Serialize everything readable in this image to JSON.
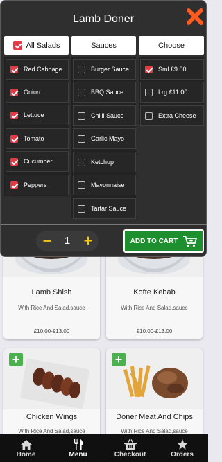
{
  "modal": {
    "title": "Lamb Doner",
    "columns": {
      "salads": {
        "header": "All Salads",
        "header_checked": true,
        "items": [
          {
            "label": "Red Cabbage",
            "checked": true
          },
          {
            "label": "Onion",
            "checked": true
          },
          {
            "label": "Lettuce",
            "checked": true
          },
          {
            "label": "Tomato",
            "checked": true
          },
          {
            "label": "Cucumber",
            "checked": true
          },
          {
            "label": "Peppers",
            "checked": true
          }
        ]
      },
      "sauces": {
        "header": "Sauces",
        "items": [
          {
            "label": "Burger Sauce",
            "checked": false
          },
          {
            "label": "BBQ Sauce",
            "checked": false
          },
          {
            "label": "Chilli Sauce",
            "checked": false
          },
          {
            "label": "Garlic Mayo",
            "checked": false
          },
          {
            "label": "Ketchup",
            "checked": false
          },
          {
            "label": "Mayonnaise",
            "checked": false
          },
          {
            "label": "Tartar Sauce",
            "checked": false
          }
        ]
      },
      "choose": {
        "header": "Choose",
        "items": [
          {
            "label": "Sml £9.00",
            "checked": true
          },
          {
            "label": "Lrg £11.00",
            "checked": false
          },
          {
            "label": "Extra Cheese",
            "checked": false
          }
        ]
      }
    },
    "quantity": {
      "minus": "−",
      "value": "1",
      "plus": "+"
    },
    "add_to_cart": "ADD TO CART"
  },
  "menu_items": [
    {
      "name": "Lamb Shish",
      "desc": "With Rice And Salad,sauce",
      "price": "£10.00-£13.00"
    },
    {
      "name": "Kofte Kebab",
      "desc": "With Rice And Salad,sauce",
      "price": "£10.00-£13.00"
    },
    {
      "name": "Chicken Wings",
      "desc": "With Rice And Salad,sauce",
      "price": ""
    },
    {
      "name": "Doner Meat And Chips",
      "desc": "With Rice And Salad,sauce",
      "price": ""
    }
  ],
  "bottom_nav": [
    {
      "label": "Home",
      "icon": "home-icon"
    },
    {
      "label": "Menu",
      "icon": "cutlery-icon",
      "active": true
    },
    {
      "label": "Checkout",
      "icon": "basket-icon"
    },
    {
      "label": "Orders",
      "icon": "star-icon"
    }
  ],
  "colors": {
    "accent_red": "#e53945",
    "close_orange": "#ff5a1f",
    "cart_green": "#1e8f2e",
    "qty_yellow": "#f5c518",
    "add_green": "#4caf50"
  }
}
